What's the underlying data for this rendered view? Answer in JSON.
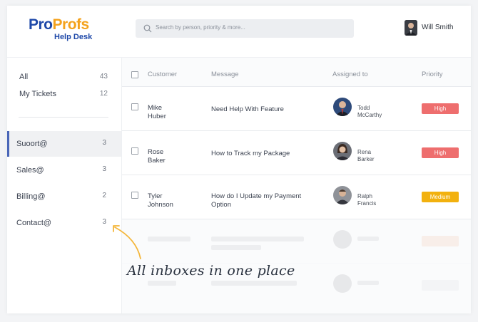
{
  "brand": {
    "logo_pro": "Pro",
    "logo_profs": "Profs",
    "logo_sub": "Help Desk"
  },
  "search": {
    "placeholder": "Search by person, priority & more..."
  },
  "user": {
    "name": "Will Smith"
  },
  "sidebar": {
    "views": [
      {
        "label": "All",
        "count": "43"
      },
      {
        "label": "My Tickets",
        "count": "12"
      }
    ],
    "inboxes": [
      {
        "label": "Suoort@",
        "count": "3",
        "active": true
      },
      {
        "label": "Sales@",
        "count": "3"
      },
      {
        "label": "Billing@",
        "count": "2"
      },
      {
        "label": "Contact@",
        "count": "3"
      }
    ]
  },
  "table": {
    "headers": {
      "customer": "Customer",
      "message": "Message",
      "assigned": "Assigned to",
      "priority": "Priority"
    },
    "rows": [
      {
        "customer_first": "Mike",
        "customer_last": "Huber",
        "message_line1": "Need Help With Feature",
        "message_line2": "",
        "agent_first": "Todd",
        "agent_last": "McCarthy",
        "priority": "High",
        "priority_color": "#ee6e6e"
      },
      {
        "customer_first": "Rose",
        "customer_last": "Baker",
        "message_line1": "How to Track my Package",
        "message_line2": "",
        "agent_first": "Rena",
        "agent_last": "Barker",
        "priority": "High",
        "priority_color": "#ee6e6e"
      },
      {
        "customer_first": "Tyler",
        "customer_last": "Johnson",
        "message_line1": "How do I Update my Payment",
        "message_line2": "Option",
        "agent_first": "Ralph",
        "agent_last": "Francis",
        "priority": "Medium",
        "priority_color": "#f2b10f"
      }
    ]
  },
  "annotation": {
    "text": "All inboxes in one place",
    "color": "#f4b63a"
  }
}
